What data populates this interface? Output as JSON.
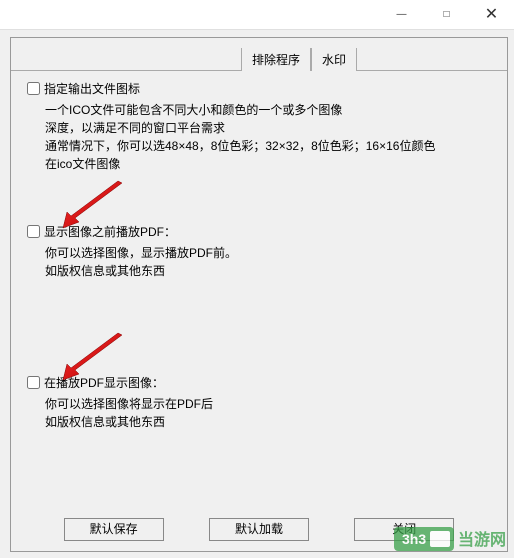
{
  "titlebar": {
    "minimize": "—",
    "maximize": "□",
    "close": "✕"
  },
  "tabs": {
    "t1": "排除程序",
    "t2": "水印"
  },
  "section1": {
    "checkbox_label": "指定输出文件图标",
    "line1": "一个ICO文件可能包含不同大小和颜色的一个或多个图像",
    "line2": "深度，以满足不同的窗口平台需求",
    "line3": "通常情况下，你可以选48×48，8位色彩；32×32，8位色彩；16×16位颜色",
    "line4": "在ico文件图像"
  },
  "section2": {
    "checkbox_label": "显示图像之前播放PDF：",
    "line1": "你可以选择图像，显示播放PDF前。",
    "line2": "如版权信息或其他东西"
  },
  "section3": {
    "checkbox_label": "在播放PDF显示图像：",
    "line1": "你可以选择图像将显示在PDF后",
    "line2": "如版权信息或其他东西"
  },
  "buttons": {
    "b1": "默认保存",
    "b2": "默认加载",
    "b3": "关闭"
  },
  "watermark": {
    "text": "当游网"
  }
}
